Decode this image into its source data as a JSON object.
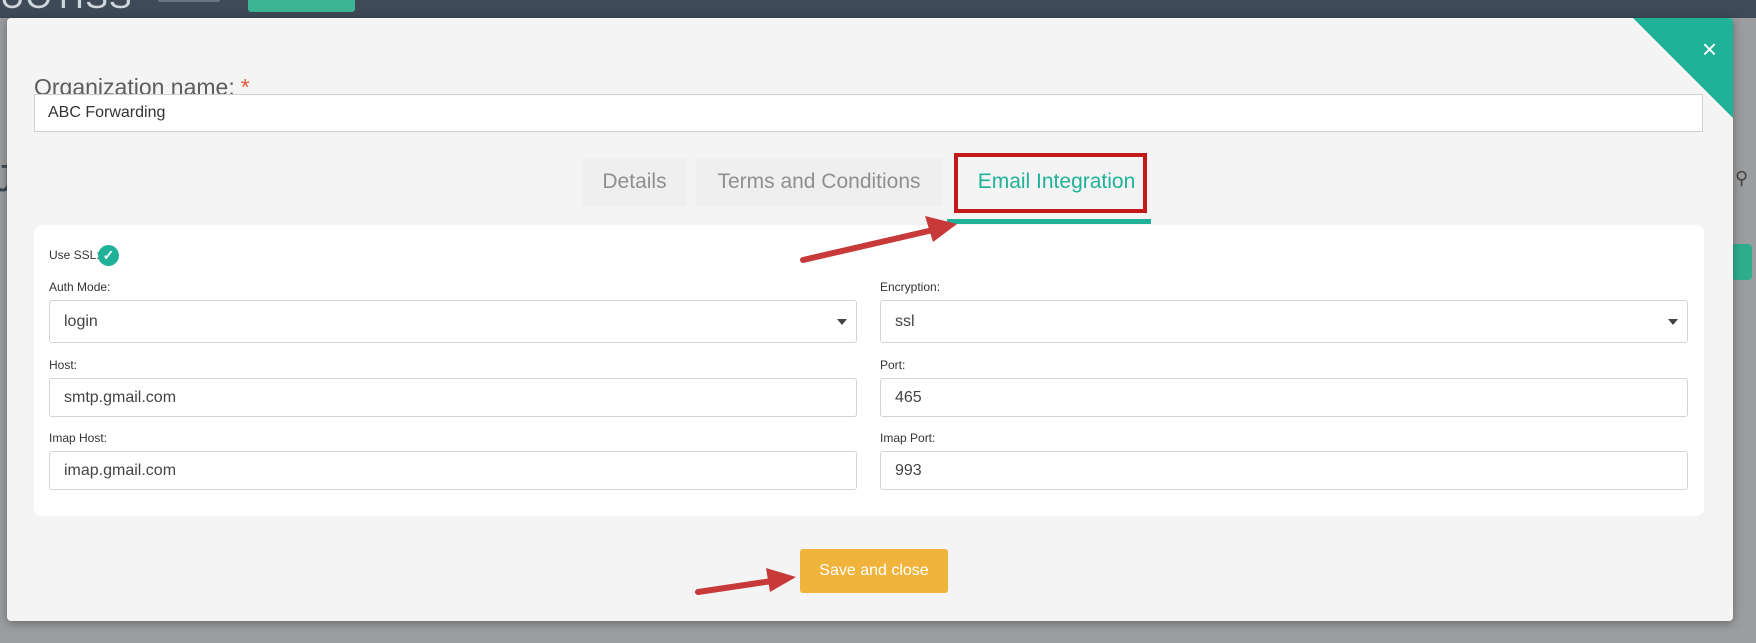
{
  "background": {
    "logo_text": "UOTISS",
    "search_icon": "search-icon"
  },
  "modal": {
    "close_glyph": "×",
    "org_label": "Organization name:",
    "required_mark": "*",
    "org_value": "ABC Forwarding"
  },
  "tabs": [
    {
      "label": "Details",
      "active": false
    },
    {
      "label": "Terms and Conditions",
      "active": false
    },
    {
      "label": "Email Integration",
      "active": true
    }
  ],
  "form": {
    "use_ssl_label": "Use SSL:",
    "use_ssl_checked": true,
    "auth_mode_label": "Auth Mode:",
    "auth_mode_value": "login",
    "encryption_label": "Encryption:",
    "encryption_value": "ssl",
    "host_label": "Host:",
    "host_value": "smtp.gmail.com",
    "port_label": "Port:",
    "port_value": "465",
    "imap_host_label": "Imap Host:",
    "imap_host_value": "imap.gmail.com",
    "imap_port_label": "Imap Port:",
    "imap_port_value": "993"
  },
  "actions": {
    "save_label": "Save and close"
  },
  "colors": {
    "accent": "#1fb298",
    "save_button": "#f0b33c",
    "annotation_red": "#c21a1a"
  }
}
